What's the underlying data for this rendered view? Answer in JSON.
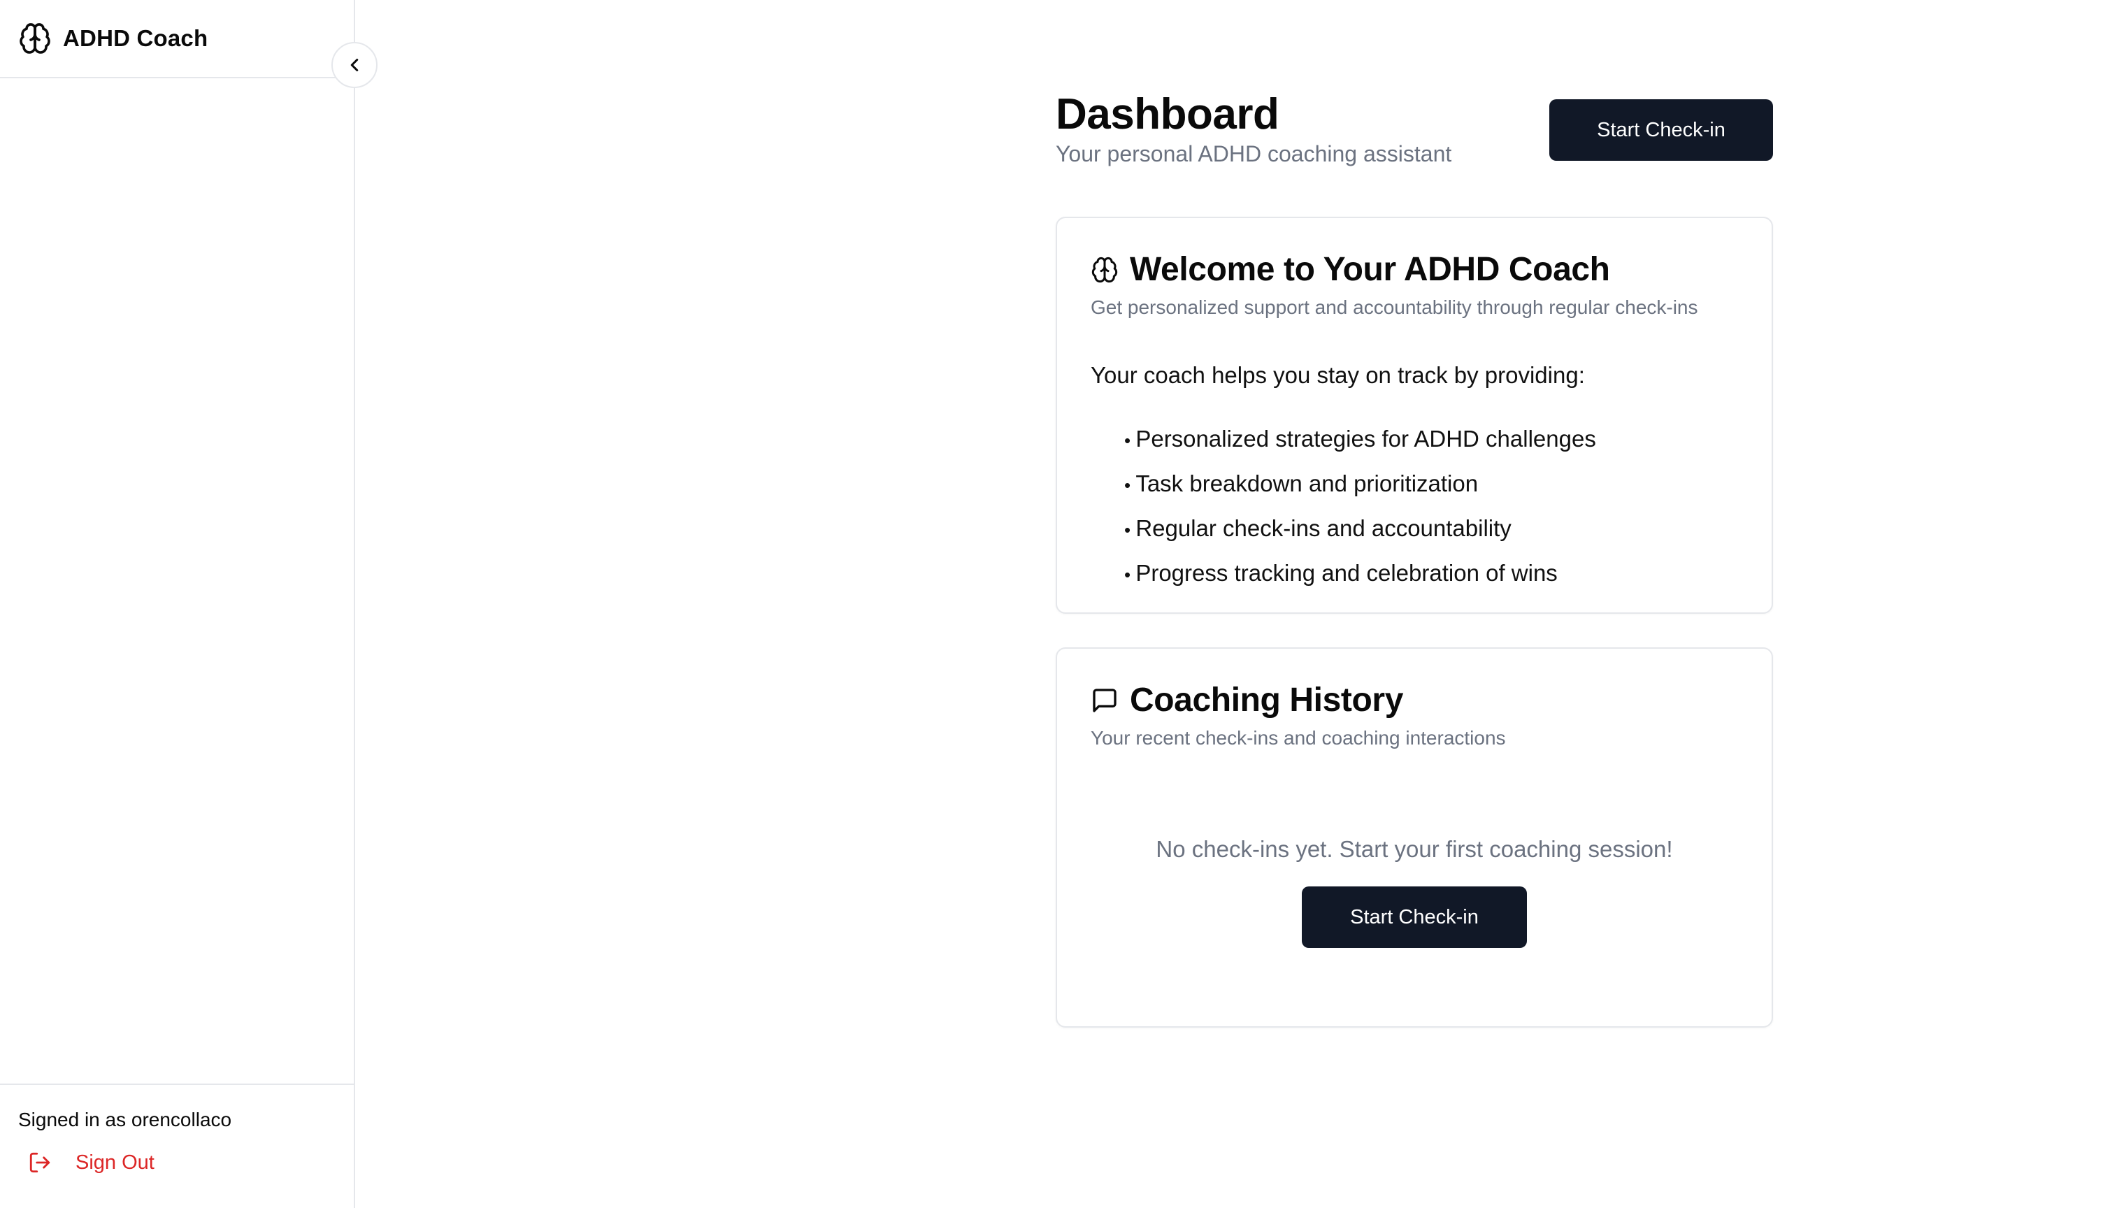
{
  "sidebar": {
    "app_title": "ADHD Coach",
    "signed_in_text": "Signed in as orencollaco",
    "sign_out_label": "Sign Out"
  },
  "header": {
    "title": "Dashboard",
    "subtitle": "Your personal ADHD coaching assistant",
    "start_checkin_label": "Start Check-in"
  },
  "welcome_card": {
    "title": "Welcome to Your ADHD Coach",
    "description": "Get personalized support and accountability through regular check-ins",
    "intro": "Your coach helps you stay on track by providing:",
    "features": [
      "Personalized strategies for ADHD challenges",
      "Task breakdown and prioritization",
      "Regular check-ins and accountability",
      "Progress tracking and celebration of wins"
    ]
  },
  "history_card": {
    "title": "Coaching History",
    "description": "Your recent check-ins and coaching interactions",
    "empty_message": "No check-ins yet. Start your first coaching session!",
    "start_checkin_label": "Start Check-in"
  },
  "colors": {
    "primary_button": "#111827",
    "muted_text": "#6b7280",
    "danger": "#dc2626",
    "border": "#e5e7eb"
  },
  "icons": {
    "brand": "brain-icon",
    "collapse": "chevron-left-icon",
    "sign_out": "log-out-icon",
    "history": "message-square-icon"
  }
}
